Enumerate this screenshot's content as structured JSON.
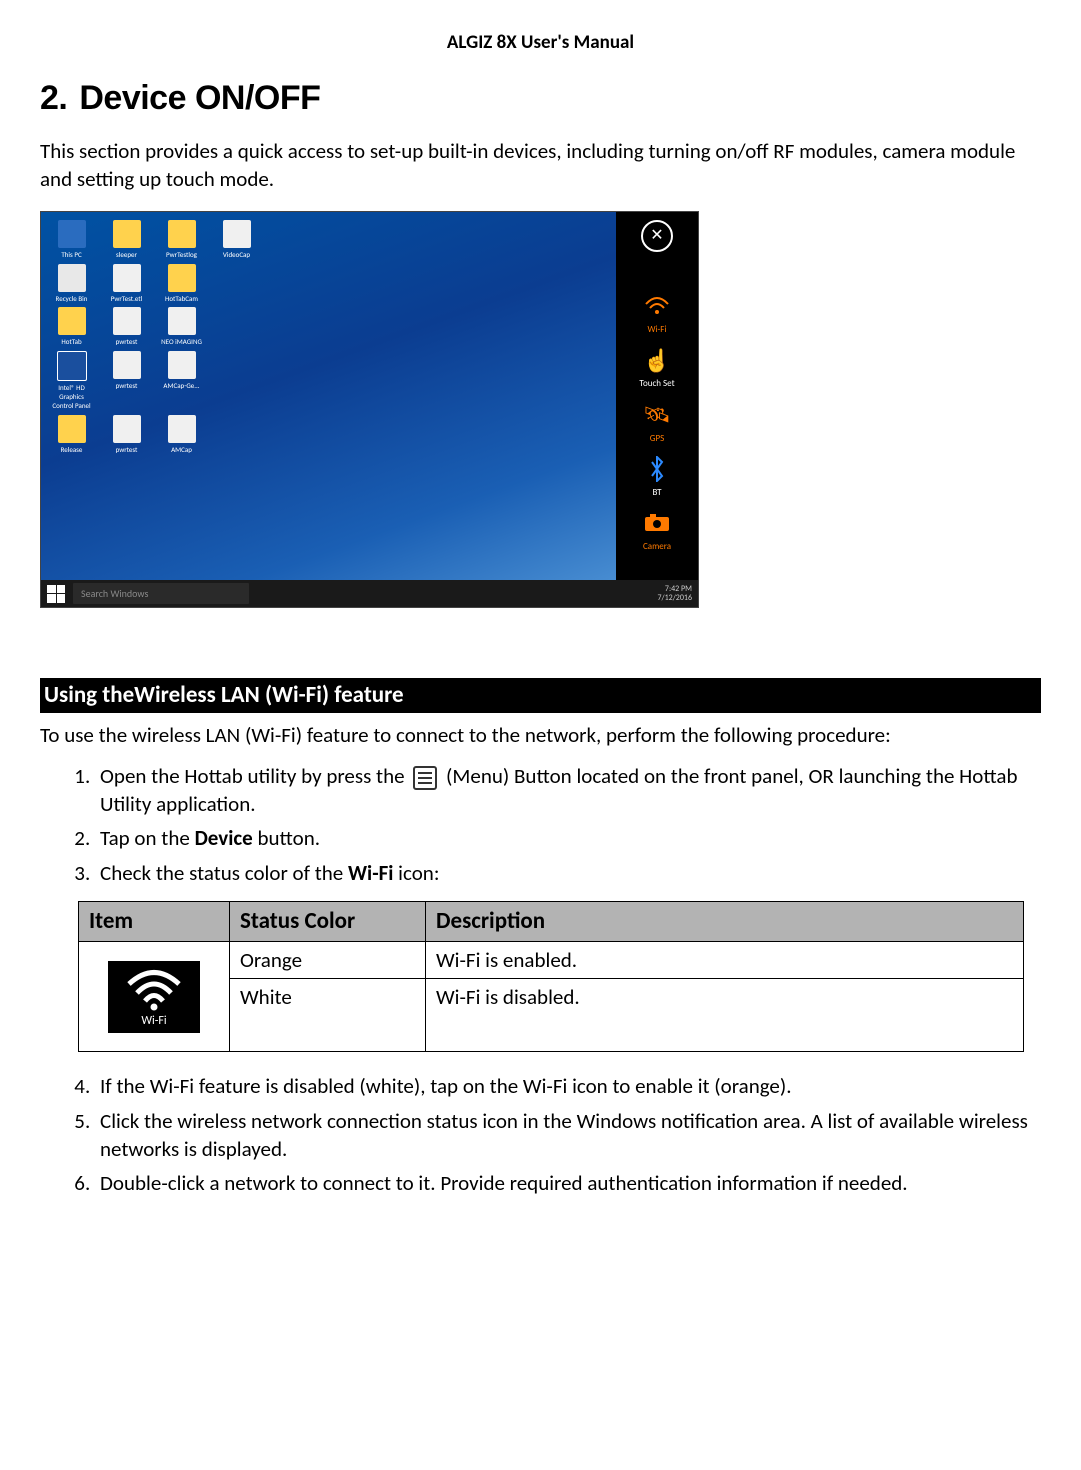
{
  "header": {
    "title": "ALGIZ 8X User's Manual"
  },
  "heading": {
    "number": "2.",
    "text": "Device ON/OFF"
  },
  "intro": "This section provides a quick access to set-up built-in devices, including turning on/off RF modules, camera module and setting up touch mode.",
  "screenshot": {
    "searchPlaceholder": "Search Windows",
    "time": "7:42 PM",
    "date": "7/12/2016",
    "desktopIcons": [
      "This PC",
      "sleeper",
      "PwrTestlog",
      "VideoCap",
      "Recycle Bin",
      "PwrTest.etl",
      "HotTabCam",
      "",
      "HotTab",
      "pwrtest",
      "NEO iMAGING",
      "",
      "Intel® HD Graphics Control Panel",
      "pwrtest",
      "AMCap-Ge...",
      "",
      "Release",
      "pwrtest",
      "AMCap",
      ""
    ],
    "sidebar": {
      "items": [
        {
          "label": "Wi-Fi",
          "glyph": "wifi",
          "color": "orange"
        },
        {
          "label": "Touch Set",
          "glyph": "touch",
          "color": "white"
        },
        {
          "label": "GPS",
          "glyph": "gps",
          "color": "orange"
        },
        {
          "label": "BT",
          "glyph": "bt",
          "color": "blue"
        },
        {
          "label": "Camera",
          "glyph": "camera",
          "color": "orange"
        }
      ]
    }
  },
  "subheading": "Using theWireless LAN (Wi-Fi) feature",
  "sub_intro": "To use the wireless LAN (Wi-Fi) feature to connect to the network, perform the following procedure:",
  "steps": {
    "s1a": "Open the Hottab utility by press the ",
    "s1b": " (Menu) Button located on the front panel, OR launching the Hottab Utility application.",
    "s2a": "Tap on the ",
    "s2b": "Device",
    "s2c": " button.",
    "s3a": "Check the status color of the ",
    "s3b": "Wi-Fi",
    "s3c": " icon:",
    "s4": "If the Wi-Fi feature is disabled (white), tap on the Wi-Fi icon to enable it (orange).",
    "s5": "Click the wireless network connection status icon in the Windows notification area. A list of available wireless networks is displayed.",
    "s6": "Double-click a network to connect to it. Provide required authentication information if needed."
  },
  "table": {
    "headers": [
      "Item",
      "Status Color",
      "Description"
    ],
    "iconLabel": "Wi-Fi",
    "rows": [
      {
        "color": "Orange",
        "desc": "Wi-Fi is enabled."
      },
      {
        "color": "White",
        "desc": "Wi-Fi is disabled."
      }
    ]
  }
}
